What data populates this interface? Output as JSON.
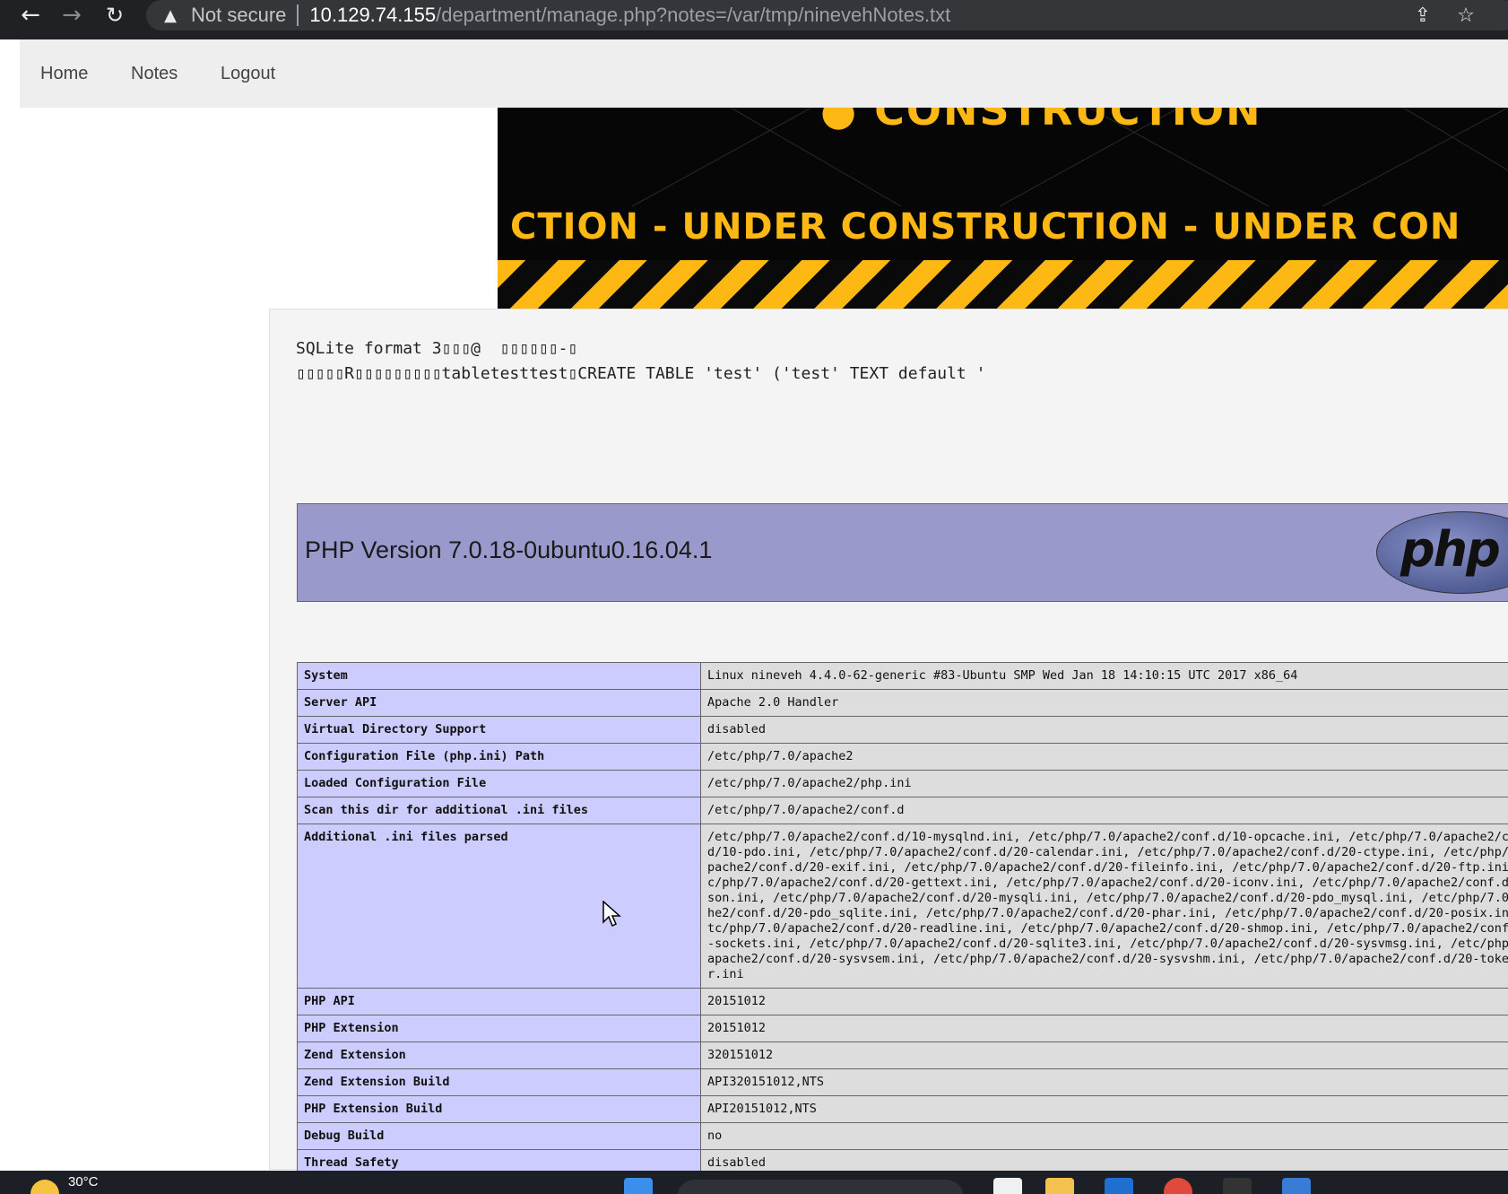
{
  "browser": {
    "security_label": "Not secure",
    "url_host": "10.129.74.155",
    "url_path": "/department/manage.php?notes=/var/tmp/ninevehNotes.txt",
    "icons": [
      "back-arrow-icon",
      "forward-arrow-icon",
      "reload-icon",
      "warning-icon",
      "share-icon",
      "star-icon"
    ]
  },
  "site_nav": {
    "items": [
      {
        "label": "Home"
      },
      {
        "label": "Notes"
      },
      {
        "label": "Logout"
      }
    ]
  },
  "banner": {
    "top_text": "● CONSTRUCTION",
    "main_text": "CTION - UNDER  CONSTRUCTION - UNDER  CON",
    "colors": {
      "yellow": "#fdb813",
      "black": "#060606"
    }
  },
  "sqlite": {
    "line1": "SQLite format 3▯▯▯@  ▯▯▯▯▯▯-▯",
    "line2": "▯▯▯▯▯R▯▯▯▯▯▯▯▯▯tabletesttest▯CREATE TABLE 'test' ('test' TEXT default '"
  },
  "phpinfo": {
    "title": "PHP Version 7.0.18-0ubuntu0.16.04.1",
    "logo_text": "php",
    "header_color": "#9999cc",
    "rows": [
      {
        "key": "System",
        "value": "Linux nineveh 4.4.0-62-generic #83-Ubuntu SMP Wed Jan 18 14:10:15 UTC 2017 x86_64"
      },
      {
        "key": "Server API",
        "value": "Apache 2.0 Handler"
      },
      {
        "key": "Virtual Directory Support",
        "value": "disabled"
      },
      {
        "key": "Configuration File (php.ini) Path",
        "value": "/etc/php/7.0/apache2"
      },
      {
        "key": "Loaded Configuration File",
        "value": "/etc/php/7.0/apache2/php.ini"
      },
      {
        "key": "Scan this dir for additional .ini files",
        "value": "/etc/php/7.0/apache2/conf.d"
      },
      {
        "key": "Additional .ini files parsed",
        "value": "/etc/php/7.0/apache2/conf.d/10-mysqlnd.ini, /etc/php/7.0/apache2/conf.d/10-opcache.ini, /etc/php/7.0/apache2/co\nd/10-pdo.ini, /etc/php/7.0/apache2/conf.d/20-calendar.ini, /etc/php/7.0/apache2/conf.d/20-ctype.ini, /etc/php/7\npache2/conf.d/20-exif.ini, /etc/php/7.0/apache2/conf.d/20-fileinfo.ini, /etc/php/7.0/apache2/conf.d/20-ftp.ini,\nc/php/7.0/apache2/conf.d/20-gettext.ini, /etc/php/7.0/apache2/conf.d/20-iconv.ini, /etc/php/7.0/apache2/conf.d/\nson.ini, /etc/php/7.0/apache2/conf.d/20-mysqli.ini, /etc/php/7.0/apache2/conf.d/20-pdo_mysql.ini, /etc/php/7.0/\nhe2/conf.d/20-pdo_sqlite.ini, /etc/php/7.0/apache2/conf.d/20-phar.ini, /etc/php/7.0/apache2/conf.d/20-posix.ini\ntc/php/7.0/apache2/conf.d/20-readline.ini, /etc/php/7.0/apache2/conf.d/20-shmop.ini, /etc/php/7.0/apache2/conf.\n-sockets.ini, /etc/php/7.0/apache2/conf.d/20-sqlite3.ini, /etc/php/7.0/apache2/conf.d/20-sysvmsg.ini, /etc/php/\napache2/conf.d/20-sysvsem.ini, /etc/php/7.0/apache2/conf.d/20-sysvshm.ini, /etc/php/7.0/apache2/conf.d/20-token\nr.ini"
      },
      {
        "key": "PHP API",
        "value": "20151012"
      },
      {
        "key": "PHP Extension",
        "value": "20151012"
      },
      {
        "key": "Zend Extension",
        "value": "320151012"
      },
      {
        "key": "Zend Extension Build",
        "value": "API320151012,NTS"
      },
      {
        "key": "PHP Extension Build",
        "value": "API20151012,NTS"
      },
      {
        "key": "Debug Build",
        "value": "no"
      },
      {
        "key": "Thread Safety",
        "value": "disabled"
      }
    ]
  },
  "taskbar": {
    "temperature": "30°C",
    "icons": [
      "weather-icon",
      "windows-start-icon",
      "search-box",
      "file-icon",
      "folder-icon",
      "app-icon",
      "chrome-icon",
      "app-icon",
      "app-icon"
    ]
  }
}
